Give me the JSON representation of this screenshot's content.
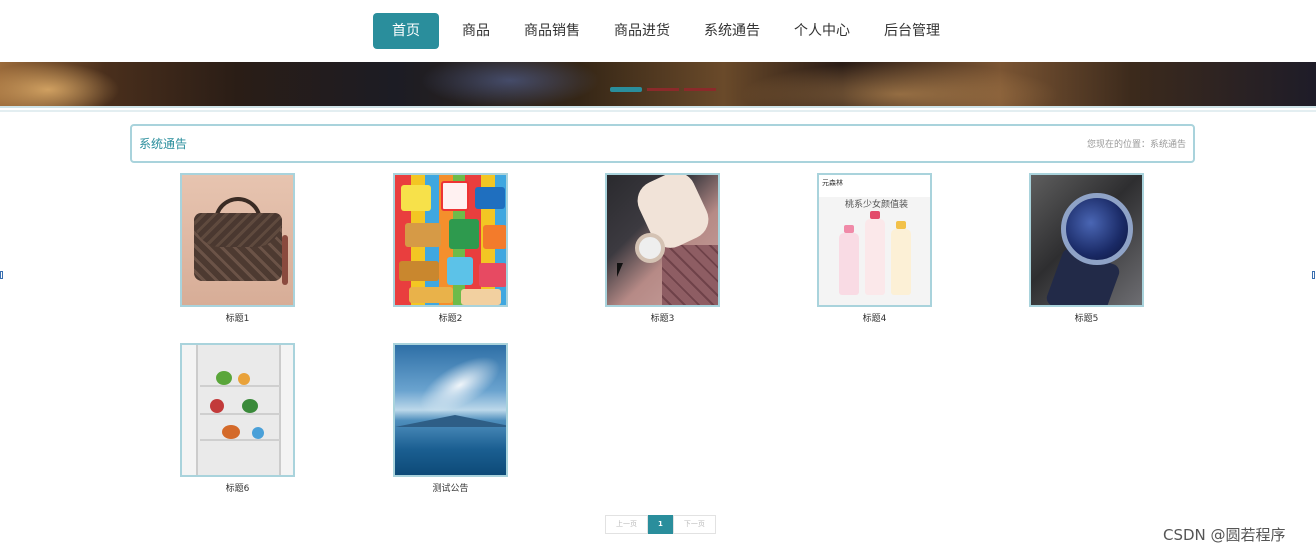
{
  "nav": {
    "items": [
      {
        "label": "首页",
        "active": true
      },
      {
        "label": "商品",
        "active": false
      },
      {
        "label": "商品销售",
        "active": false
      },
      {
        "label": "商品进货",
        "active": false
      },
      {
        "label": "系统通告",
        "active": false
      },
      {
        "label": "个人中心",
        "active": false
      },
      {
        "label": "后台管理",
        "active": false
      }
    ]
  },
  "banner": {
    "slide_count": 3,
    "active_slide": 1
  },
  "breadcrumb": {
    "title": "系统通告",
    "location_label": "您现在的位置：",
    "location_value": "系统通告"
  },
  "notices": [
    {
      "caption": "标题1",
      "image": "handbag"
    },
    {
      "caption": "标题2",
      "image": "snacks"
    },
    {
      "caption": "标题3",
      "image": "wristwatch"
    },
    {
      "caption": "标题4",
      "image": "drink-bottles"
    },
    {
      "caption": "标题5",
      "image": "blue-watch"
    },
    {
      "caption": "标题6",
      "image": "refrigerator"
    },
    {
      "caption": "测试公告",
      "image": "sky-lake"
    }
  ],
  "drink_image_text": {
    "brand": "元森林",
    "headline": "桃系少女颜值装"
  },
  "pager": {
    "prev": "上一页",
    "current": "1",
    "next": "下一页"
  },
  "watermark": "CSDN @圆若程序",
  "colors": {
    "accent": "#2a8e9c",
    "border": "#a9d3dc"
  }
}
